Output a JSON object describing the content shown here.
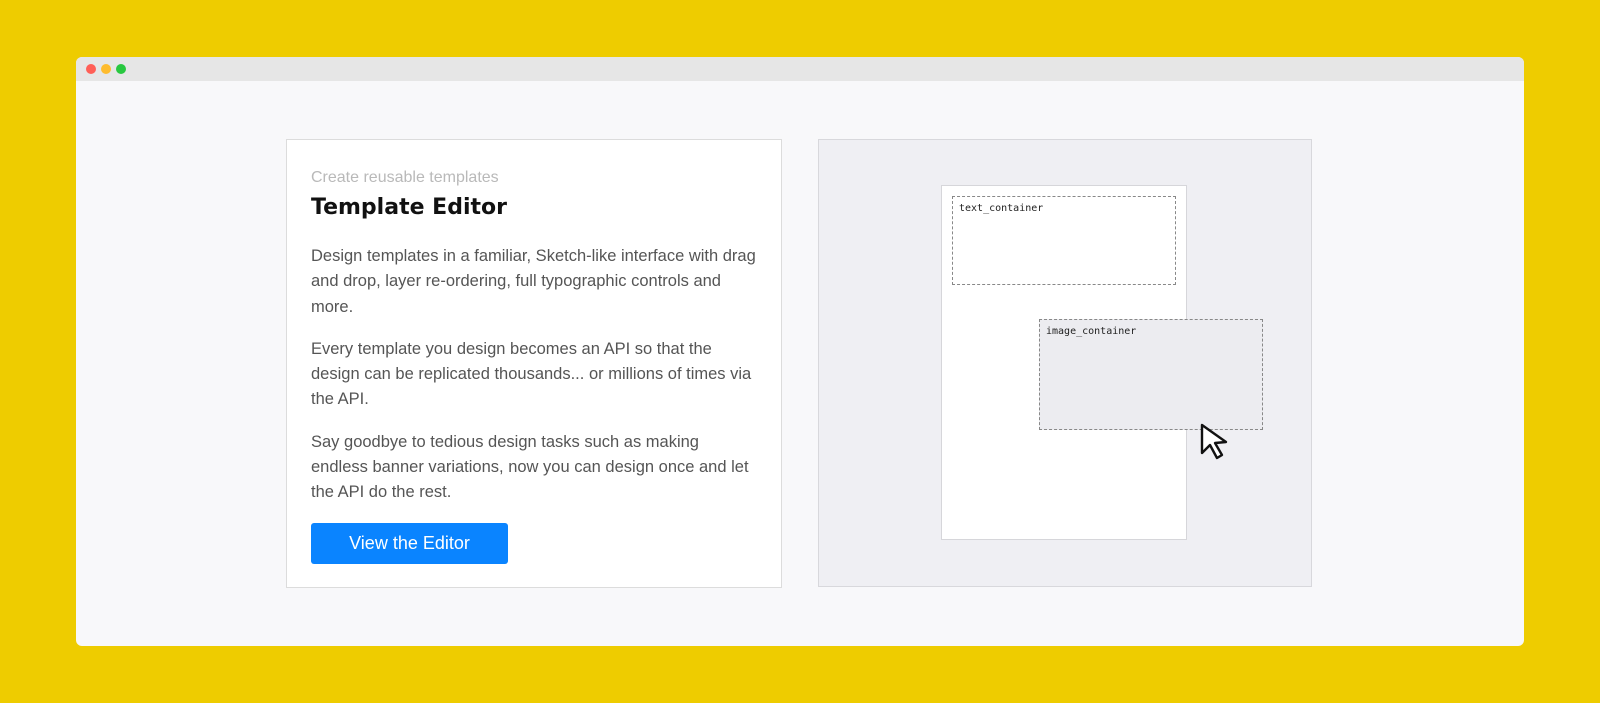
{
  "window": {
    "controls": [
      "close",
      "minimize",
      "maximize"
    ]
  },
  "feature": {
    "eyebrow": "Create reusable templates",
    "title": "Template Editor",
    "paragraphs": [
      "Design templates in a familiar, Sketch-like interface with drag and drop, layer re-ordering, full typographic controls and more.",
      "Every template you design becomes an API so that the design can be replicated thousands... or millions of times via the API.",
      "Say goodbye to tedious design tasks such as making endless banner variations, now you can design once and let the API do the rest."
    ],
    "cta_label": "View the Editor"
  },
  "preview": {
    "layers": [
      {
        "label": "text_container"
      },
      {
        "label": "image_container"
      }
    ],
    "cursor_icon": "pointer-cursor-icon"
  },
  "colors": {
    "background": "#eecc00",
    "accent": "#0a84ff",
    "window": "#f8f8fa"
  }
}
